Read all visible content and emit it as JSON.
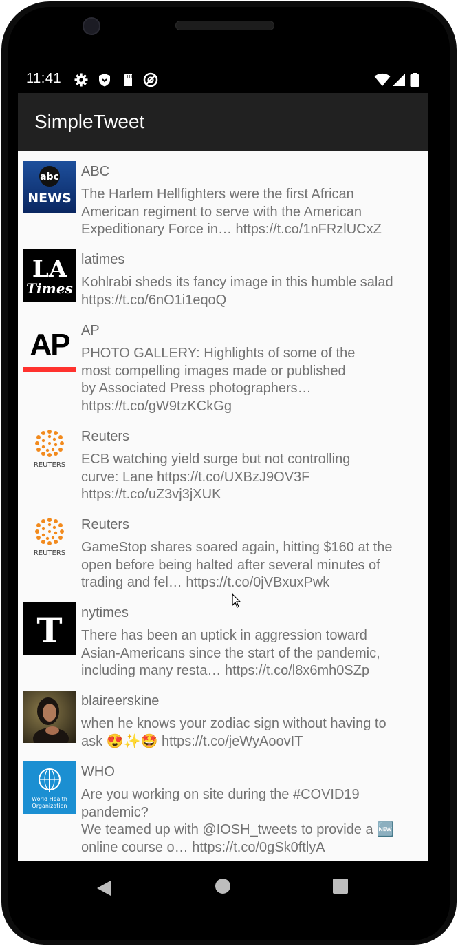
{
  "status_bar": {
    "time": "11:41",
    "left_icons": [
      "gear-icon",
      "shield-icon",
      "sd-card-icon",
      "no-data-icon"
    ],
    "right_icons": [
      "wifi-icon",
      "cell-signal-icon",
      "battery-icon"
    ]
  },
  "app_bar": {
    "title": "SimpleTweet"
  },
  "tweets": [
    {
      "user": "ABC",
      "avatar": "abc-news-logo",
      "text": "The Harlem Hellfighters were the first African\nAmerican regiment to serve with the American\nExpeditionary Force in… https://t.co/1nFRzlUCxZ"
    },
    {
      "user": "latimes",
      "avatar": "la-times-logo",
      "text": "Kohlrabi sheds its fancy image in this humble salad\nhttps://t.co/6nO1i1eqoQ"
    },
    {
      "user": "AP",
      "avatar": "ap-logo",
      "text": "PHOTO GALLERY: Highlights of some of the\nmost compelling images made or published\nby Associated Press photographers…\nhttps://t.co/gW9tzKCkGg"
    },
    {
      "user": "Reuters",
      "avatar": "reuters-logo",
      "text": "ECB watching yield surge but not controlling\ncurve: Lane https://t.co/UXBzJ9OV3F\nhttps://t.co/uZ3vj3jXUK"
    },
    {
      "user": "Reuters",
      "avatar": "reuters-logo",
      "text": "GameStop shares soared again, hitting $160 at the\nopen before being halted after several minutes of\ntrading and fel… https://t.co/0jVBxuxPwk"
    },
    {
      "user": "nytimes",
      "avatar": "nytimes-logo",
      "text": "There has been an uptick in aggression toward\nAsian-Americans since the start of the pandemic,\nincluding many resta… https://t.co/l8x6mh0SZp"
    },
    {
      "user": "blaireerskine",
      "avatar": "user-photo",
      "text": "when he knows your zodiac sign without having to\nask 😍✨🤩 https://t.co/jeWyAoovIT"
    },
    {
      "user": "WHO",
      "avatar": "who-logo",
      "text": "Are you working on site during the #COVID19\npandemic?\nWe teamed up with @IOSH_tweets to provide a 🆕\nonline course o… https://t.co/0gSk0ftlyA"
    }
  ],
  "avatar_text": {
    "abc_top": "abc",
    "abc_bottom": "NEWS",
    "la_top": "LA",
    "la_bottom": "Times",
    "ap": "AP",
    "reuters": "REUTERS",
    "nyt": "T",
    "who_line1": "World Health",
    "who_line2": "Organization"
  },
  "nav_bar": {
    "buttons": [
      "back-icon",
      "home-icon",
      "recents-icon"
    ]
  }
}
